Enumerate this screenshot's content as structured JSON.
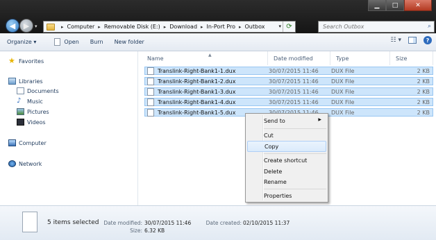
{
  "window": {
    "minimize": "▁",
    "maximize": "□",
    "close": "✕"
  },
  "address": {
    "crumbs": [
      "Computer",
      "Removable Disk (E:)",
      "Download",
      "In-Port Pro",
      "Outbox"
    ]
  },
  "search": {
    "placeholder": "Search Outbox"
  },
  "commands": {
    "organize": "Organize ▾",
    "open": "Open",
    "burn": "Burn",
    "new_folder": "New folder"
  },
  "nav": {
    "favorites": "Favorites",
    "libraries": "Libraries",
    "documents": "Documents",
    "music": "Music",
    "pictures": "Pictures",
    "videos": "Videos",
    "computer": "Computer",
    "network": "Network"
  },
  "columns": {
    "name": "Name",
    "date": "Date modified",
    "type": "Type",
    "size": "Size"
  },
  "files": [
    {
      "name": "Translink-Right-Bank1-1.dux",
      "date": "30/07/2015 11:46",
      "type": "DUX File",
      "size": "2 KB"
    },
    {
      "name": "Translink-Right-Bank1-2.dux",
      "date": "30/07/2015 11:46",
      "type": "DUX File",
      "size": "2 KB"
    },
    {
      "name": "Translink-Right-Bank1-3.dux",
      "date": "30/07/2015 11:46",
      "type": "DUX File",
      "size": "2 KB"
    },
    {
      "name": "Translink-Right-Bank1-4.dux",
      "date": "30/07/2015 11:46",
      "type": "DUX File",
      "size": "2 KB"
    },
    {
      "name": "Translink-Right-Bank1-5.dux",
      "date": "30/07/2015 11:46",
      "type": "DUX File",
      "size": "2 KB"
    }
  ],
  "context_menu": {
    "send_to": "Send to",
    "cut": "Cut",
    "copy": "Copy",
    "create_shortcut": "Create shortcut",
    "delete": "Delete",
    "rename": "Rename",
    "properties": "Properties"
  },
  "details": {
    "count": "5 items selected",
    "date_modified_label": "Date modified:",
    "date_modified": "30/07/2015 11:46",
    "size_label": "Size:",
    "size": "6.32 KB",
    "date_created_label": "Date created:",
    "date_created": "02/10/2015 11:37"
  },
  "colors": {
    "selection": "#cde5fb",
    "selection_border": "#98c6f2",
    "title_bar": "#1b1b1b"
  }
}
